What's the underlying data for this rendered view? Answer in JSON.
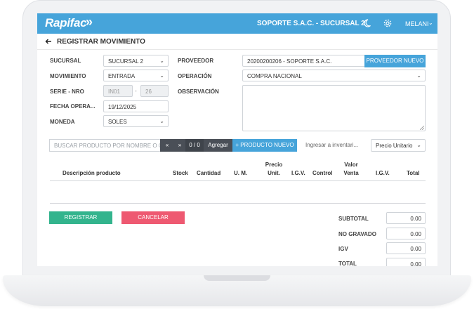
{
  "header": {
    "logo": "Rapifac",
    "company": "SOPORTE S.A.C. - SUCURSAL 2",
    "user": "MELANI",
    "brand_color": "#46a4da"
  },
  "page": {
    "title": "REGISTRAR MOVIMIENTO"
  },
  "form": {
    "sucursal": {
      "label": "SUCURSAL",
      "value": "SUCURSAL 2"
    },
    "movimiento": {
      "label": "MOVIMIENTO",
      "value": "ENTRADA"
    },
    "serie": {
      "label": "SERIE - NRO",
      "serie_value": "IN01",
      "separator": "-",
      "nro_value": "26"
    },
    "fecha": {
      "label": "FECHA OPERA...",
      "value": "19/12/2025"
    },
    "moneda": {
      "label": "MONEDA",
      "value": "SOLES"
    },
    "proveedor": {
      "label": "PROVEEDOR",
      "value": "20200200206 - SOPORTE S.A.C.",
      "button": "PROVEEDOR NUEVO"
    },
    "operacion": {
      "label": "OPERACIÓN",
      "value": "COMPRA NACIONAL"
    },
    "observacion": {
      "label": "OBSERVACIÓN",
      "value": ""
    }
  },
  "toolbar": {
    "search_placeholder": "BUSCAR PRODUCTO POR NOMBRE O CÓDIGO",
    "first_label": "«",
    "next_label": "»",
    "pager": "0 / 0",
    "add_label": "Agregar",
    "new_product_label": "+ PRODUCTO NUEVO",
    "inventory_placeholder": "Ingresar a inventari...",
    "price_select": "Precio Unitario"
  },
  "table": {
    "columns": [
      {
        "label": "Descripción producto"
      },
      {
        "label": "Stock"
      },
      {
        "label": "Cantidad"
      },
      {
        "label": "U. M."
      },
      {
        "label_line1": "Precio",
        "label_line2": "Unit."
      },
      {
        "label": "I.G.V."
      },
      {
        "label": "Control"
      },
      {
        "label_line1": "Valor",
        "label_line2": "Venta"
      },
      {
        "label": "I.G.V."
      },
      {
        "label": "Total"
      }
    ]
  },
  "actions": {
    "register": "REGISTRAR",
    "cancel": "CANCELAR",
    "register_color": "#33b48d",
    "cancel_color": "#ee5971"
  },
  "totals": {
    "subtotal": {
      "label": "SUBTOTAL",
      "value": "0.00"
    },
    "no_gravado": {
      "label": "NO GRAVADO",
      "value": "0.00"
    },
    "igv": {
      "label": "IGV",
      "value": "0.00"
    },
    "total": {
      "label": "TOTAL",
      "value": "0.00"
    }
  }
}
